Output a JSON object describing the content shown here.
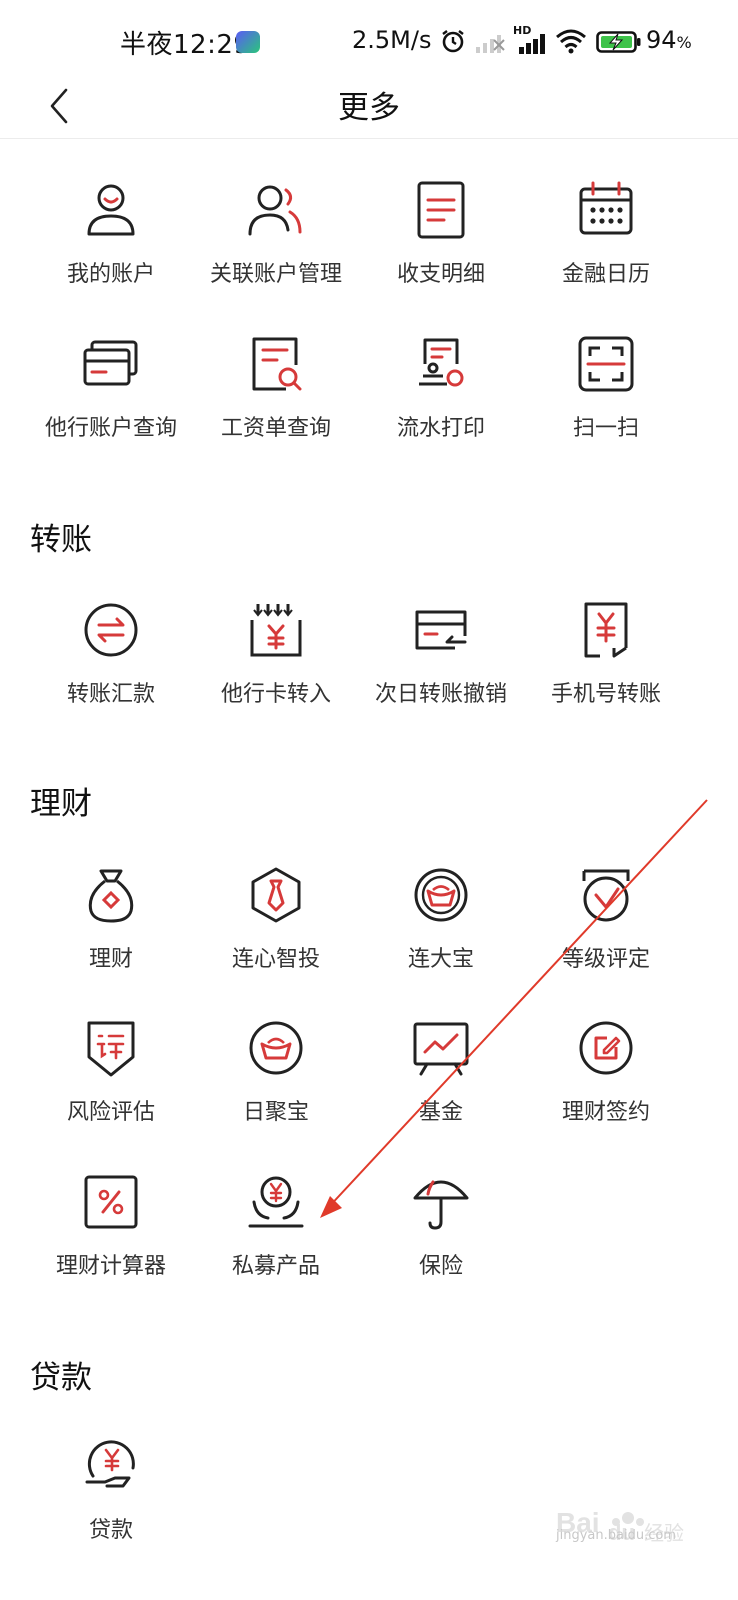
{
  "status_bar": {
    "time": "半夜12:29",
    "net_speed": "2.5M/s",
    "battery": "94",
    "battery_unit": "%",
    "signal_tag": "HD",
    "app_icon_name": "iqiyi-app-icon"
  },
  "header": {
    "title": "更多",
    "back_icon": "chevron-left-icon"
  },
  "accent_color": "#d63a3a",
  "top_grid": [
    {
      "label": "我的账户",
      "icon": "user-icon"
    },
    {
      "label": "关联账户管理",
      "icon": "linked-users-icon"
    },
    {
      "label": "收支明细",
      "icon": "document-list-icon"
    },
    {
      "label": "金融日历",
      "icon": "calendar-icon"
    },
    {
      "label": "他行账户查询",
      "icon": "cards-icon"
    },
    {
      "label": "工资单查询",
      "icon": "payslip-search-icon"
    },
    {
      "label": "流水打印",
      "icon": "statement-print-icon"
    },
    {
      "label": "扫一扫",
      "icon": "scan-icon"
    }
  ],
  "sections": [
    {
      "title": "转账",
      "items": [
        {
          "label": "转账汇款",
          "icon": "transfer-icon"
        },
        {
          "label": "他行卡转入",
          "icon": "card-in-icon"
        },
        {
          "label": "次日转账撤销",
          "icon": "transfer-revoke-icon"
        },
        {
          "label": "手机号转账",
          "icon": "phone-transfer-icon"
        }
      ]
    },
    {
      "title": "理财",
      "items": [
        {
          "label": "理财",
          "icon": "money-bag-icon"
        },
        {
          "label": "连心智投",
          "icon": "tie-hexagon-icon"
        },
        {
          "label": "连大宝",
          "icon": "ingot-icon"
        },
        {
          "label": "等级评定",
          "icon": "rating-badge-icon"
        },
        {
          "label": "风险评估",
          "icon": "risk-shield-icon"
        },
        {
          "label": "日聚宝",
          "icon": "gold-ingot-icon"
        },
        {
          "label": "基金",
          "icon": "fund-chart-icon"
        },
        {
          "label": "理财签约",
          "icon": "sign-edit-icon"
        },
        {
          "label": "理财计算器",
          "icon": "percent-calculator-icon"
        },
        {
          "label": "私募产品",
          "icon": "private-fund-icon"
        },
        {
          "label": "保险",
          "icon": "umbrella-icon"
        }
      ]
    },
    {
      "title": "贷款",
      "items": [
        {
          "label": "贷款",
          "icon": "loan-hand-icon"
        }
      ]
    }
  ],
  "watermark": {
    "text": "jingyan.baidu.com",
    "logo_text": "Baidu经验"
  }
}
